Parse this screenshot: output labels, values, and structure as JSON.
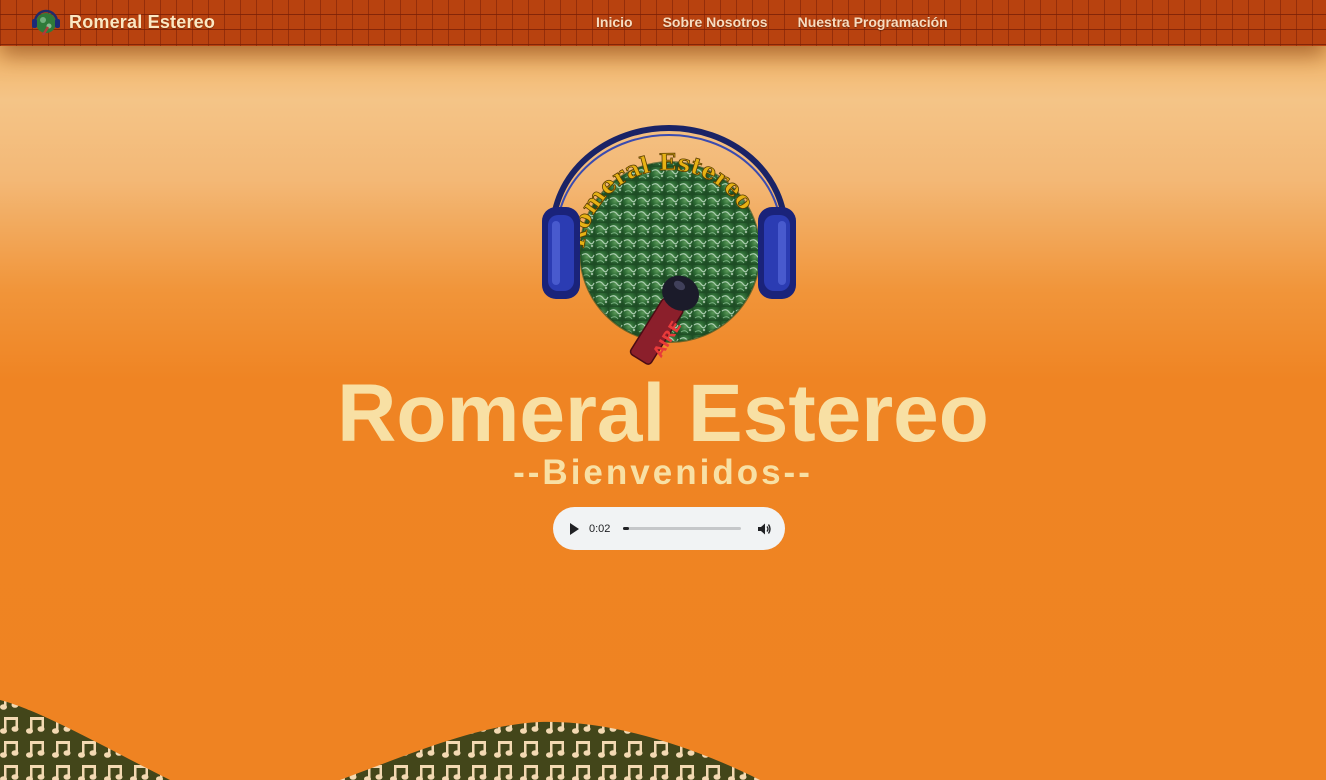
{
  "navbar": {
    "brand_name": "Romeral Estereo",
    "links": [
      "Inicio",
      "Sobre Nosotros",
      "Nuestra Programación"
    ]
  },
  "hero": {
    "title": "Romeral Estereo",
    "subtitle": "--Bienvenidos--",
    "logo_arc_text": "Romeral Estereo",
    "logo_mic_text": "AIRE"
  },
  "audio_player": {
    "time": "0:02",
    "progress_fraction": 0.05,
    "play_icon": "play-icon",
    "volume_icon": "volume-icon"
  },
  "colors": {
    "background_main": "#ef8322",
    "navbar_brick": "#b8420f",
    "title_text": "#f8e0a4",
    "wave_green": "#43461a",
    "note_color": "#f3d9b2"
  }
}
